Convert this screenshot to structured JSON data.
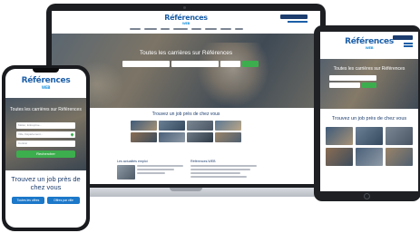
{
  "brand": {
    "name": "Références",
    "tagline": "WEB",
    "logo_color": "#1c5fa8",
    "accent_green": "#3cae4d",
    "accent_blue": "#1c78c9"
  },
  "laptop": {
    "hero_title": "Toutes les carrières sur Références",
    "jobs_title": "Trouvez un job près de chez vous",
    "blurb_left_title": "Les actualités emploi",
    "blurb_right_title": "Références.WEB"
  },
  "tablet": {
    "hero_title": "Toutes les carrières sur Références",
    "jobs_title": "Trouvez un job près de chez vous"
  },
  "phone": {
    "hero_title": "Toutes les carrières sur Références",
    "field_keyword_placeholder": "Métier, Entreprise...",
    "field_location_placeholder": "Ville, Département...",
    "field_contract_placeholder": "Contrat",
    "search_button": "Rechercher",
    "jobs_title": "Trouvez un job près de chez vous",
    "tab_left": "Toutes les offres",
    "tab_right": "Offres par ville"
  }
}
